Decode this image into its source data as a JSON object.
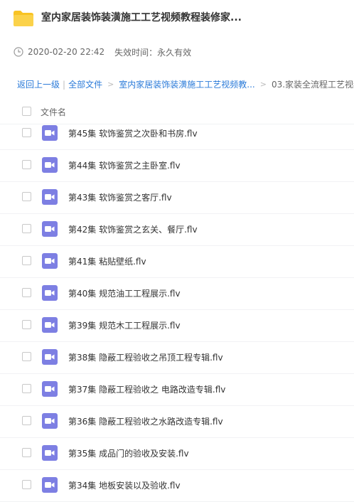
{
  "header": {
    "title": "室内家居装饰装潢施工工艺视频教程装修家...",
    "date": "2020-02-20 22:42",
    "expiry": "失效时间：永久有效"
  },
  "breadcrumb": {
    "back": "返回上一级",
    "sep": "|",
    "all_files": "全部文件",
    "folder": "室内家居装饰装潢施工工艺视频教...",
    "current": "03.家装全流程工艺视频"
  },
  "list": {
    "column_label": "文件名",
    "files": [
      {
        "name": "第45集 软饰鉴赏之次卧和书房.flv"
      },
      {
        "name": "第44集 软饰鉴赏之主卧室.flv"
      },
      {
        "name": "第43集 软饰鉴赏之客厅.flv"
      },
      {
        "name": "第42集 软饰鉴赏之玄关、餐厅.flv"
      },
      {
        "name": "第41集 粘贴壁纸.flv"
      },
      {
        "name": "第40集 规范油工工程展示.flv"
      },
      {
        "name": "第39集 规范木工工程展示.flv"
      },
      {
        "name": "第38集 隐蔽工程验收之吊顶工程专辑.flv"
      },
      {
        "name": "第37集 隐蔽工程验收之 电路改造专辑.flv"
      },
      {
        "name": "第36集 隐蔽工程验收之水路改造专辑.flv"
      },
      {
        "name": "第35集 成品门的验收及安装.flv"
      },
      {
        "name": "第34集 地板安装以及验收.flv"
      }
    ]
  },
  "colors": {
    "folder": "#f8c324",
    "video_icon": "#7d7fe3",
    "link": "#2b7bd9"
  },
  "icons": {
    "folder": "folder-icon",
    "clock": "clock-icon",
    "video": "video-file-icon"
  }
}
